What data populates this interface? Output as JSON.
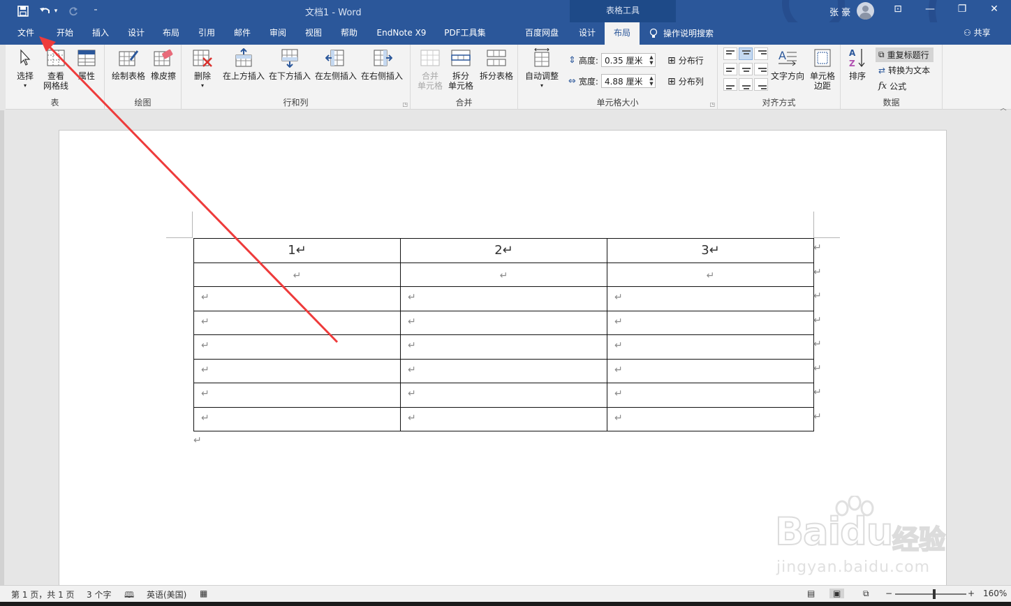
{
  "titlebar": {
    "doc_title": "文档1  -  Word",
    "context_tab": "表格工具",
    "user": "张 豪",
    "window_buttons": {
      "ribbon_options": "⊡",
      "minimize": "—",
      "restore": "❐",
      "close": "✕"
    }
  },
  "qat": {
    "save_icon": "🖫",
    "undo_icon": "↶",
    "undo_dropdown": "▾",
    "redo_icon": "↻",
    "customize": "⁼"
  },
  "tabs": [
    {
      "label": "文件"
    },
    {
      "label": "开始"
    },
    {
      "label": "插入"
    },
    {
      "label": "设计"
    },
    {
      "label": "布局"
    },
    {
      "label": "引用"
    },
    {
      "label": "邮件"
    },
    {
      "label": "审阅"
    },
    {
      "label": "视图"
    },
    {
      "label": "帮助"
    },
    {
      "label": "EndNote X9"
    },
    {
      "label": "PDF工具集"
    },
    {
      "label": "百度网盘"
    },
    {
      "label": "设计"
    },
    {
      "label": "布局"
    }
  ],
  "tell_me": "操作说明搜索",
  "share": "共享",
  "ribbon": {
    "table": {
      "label": "表",
      "select": "选择",
      "gridlines_1": "查看",
      "gridlines_2": "网格线",
      "properties": "属性"
    },
    "draw": {
      "label": "绘图",
      "draw_table": "绘制表格",
      "eraser": "橡皮擦"
    },
    "rows_cols": {
      "label": "行和列",
      "delete": "删除",
      "insert_above": "在上方插入",
      "insert_below": "在下方插入",
      "insert_left": "在左侧插入",
      "insert_right": "在右侧插入"
    },
    "merge": {
      "label": "合并",
      "merge_1": "合并",
      "merge_2": "单元格",
      "split_1": "拆分",
      "split_2": "单元格",
      "split_table": "拆分表格"
    },
    "cell_size": {
      "label": "单元格大小",
      "autofit": "自动调整",
      "height_label": "高度:",
      "height_value": "0.35 厘米",
      "width_label": "宽度:",
      "width_value": "4.88 厘米",
      "dist_rows": "分布行",
      "dist_cols": "分布列"
    },
    "alignment": {
      "label": "对齐方式",
      "text_dir": "文字方向",
      "margins_1": "单元格",
      "margins_2": "边距"
    },
    "data": {
      "label": "数据",
      "sort": "排序",
      "repeat_header": "重复标题行",
      "to_text": "转换为文本",
      "formula": "公式"
    }
  },
  "document": {
    "headers": [
      "1↵",
      "2↵",
      "3↵"
    ],
    "mark": "↵"
  },
  "watermark": {
    "brand": "Bai",
    "brand2": "du",
    "cn": "经验",
    "url": "jingyan.baidu.com"
  },
  "status": {
    "page": "第 1 页，共 1 页",
    "words": "3 个字",
    "language": "英语(美国)",
    "zoom": "160%"
  }
}
